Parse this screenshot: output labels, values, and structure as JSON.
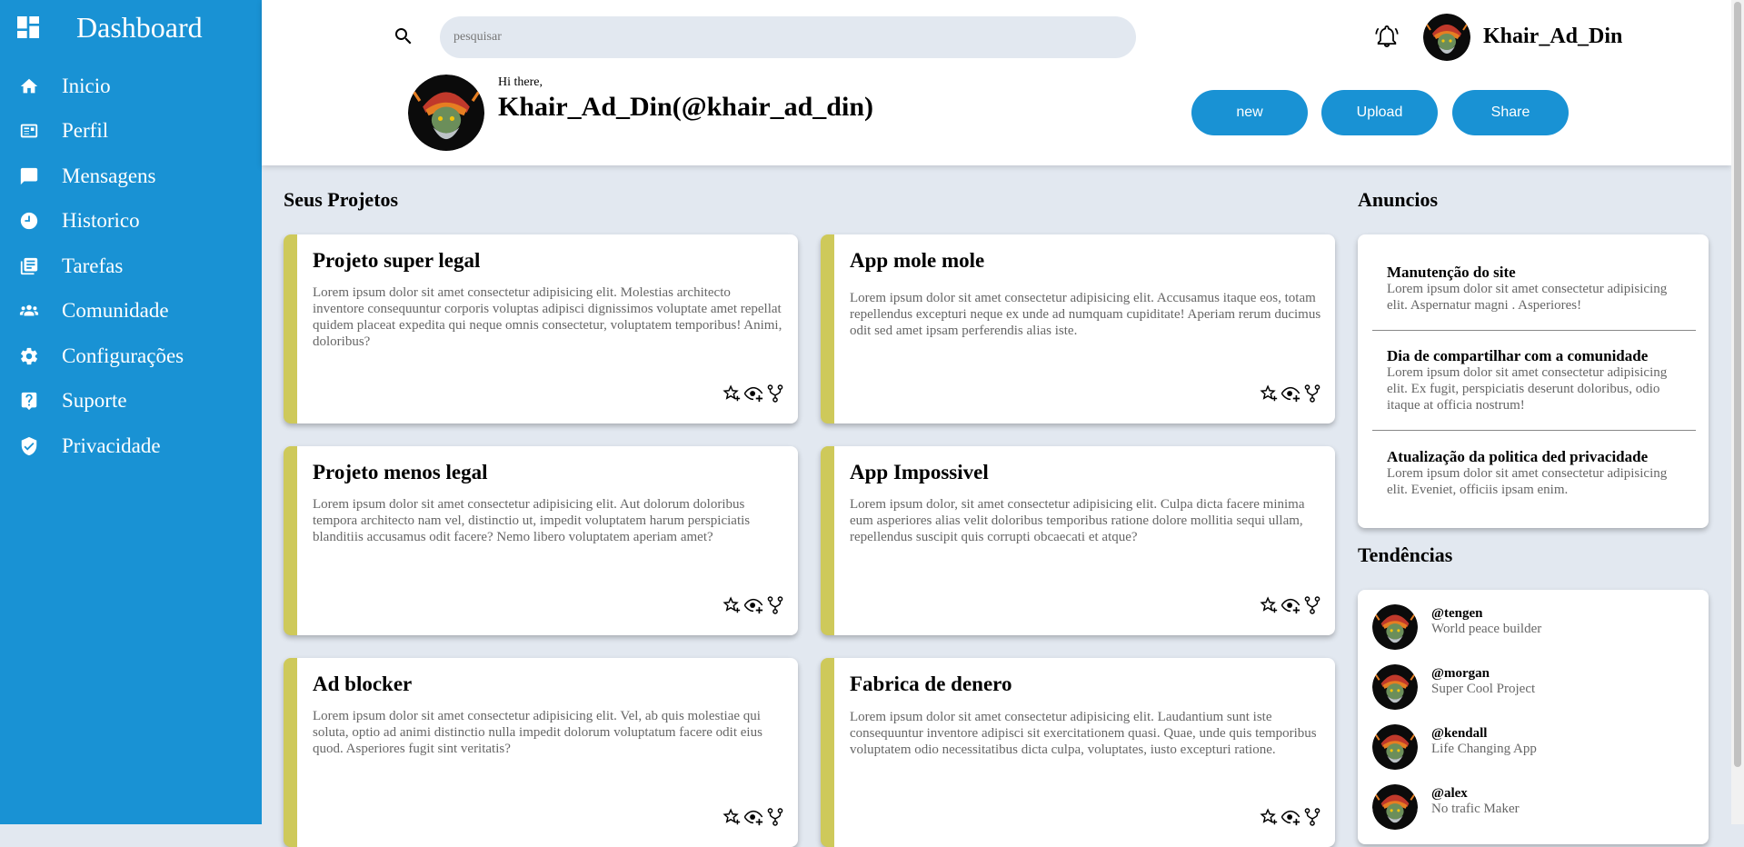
{
  "sidebar": {
    "title": "Dashboard",
    "items": [
      {
        "label": "Inicio",
        "icon": "home-icon"
      },
      {
        "label": "Perfil",
        "icon": "profile-card-icon"
      },
      {
        "label": "Mensagens",
        "icon": "message-icon"
      },
      {
        "label": "Historico",
        "icon": "clock-icon"
      },
      {
        "label": "Tarefas",
        "icon": "tasks-icon"
      },
      {
        "label": "Comunidade",
        "icon": "community-icon"
      },
      {
        "label": "Configurações",
        "icon": "gear-icon"
      },
      {
        "label": "Suporte",
        "icon": "help-icon"
      },
      {
        "label": "Privacidade",
        "icon": "shield-icon"
      }
    ]
  },
  "header": {
    "search_placeholder": "pesquisar",
    "username": "Khair_Ad_Din",
    "greeting": "Hi there,",
    "profile_handle": "Khair_Ad_Din(@khair_ad_din)",
    "buttons": {
      "new": "new",
      "upload": "Upload",
      "share": "Share"
    }
  },
  "projects": {
    "title": "Seus Projetos",
    "items": [
      {
        "title": "Projeto super legal",
        "text": "Lorem ipsum dolor sit amet consectetur adipisicing elit. Molestias architecto inventore consequuntur corporis voluptas adipisci dignissimos voluptate amet repellat quidem placeat expedita qui neque omnis consectetur, voluptatem temporibus! Animi, doloribus?"
      },
      {
        "title": "App mole mole",
        "text": "Lorem ipsum dolor sit amet consectetur adipisicing elit. Accusamus itaque eos, totam repellendus excepturi neque ex unde ad numquam cupiditate! Aperiam rerum ducimus odit sed amet ipsam perferendis alias iste."
      },
      {
        "title": "Projeto menos legal",
        "text": "Lorem ipsum dolor sit amet consectetur adipisicing elit. Aut dolorum doloribus tempora architecto nam vel, distinctio ut, impedit voluptatem harum perspiciatis blanditiis accusamus odit facere? Nemo libero voluptatem aperiam amet?"
      },
      {
        "title": "App Impossivel",
        "text": "Lorem ipsum dolor, sit amet consectetur adipisicing elit. Culpa dicta facere minima eum asperiores alias velit doloribus temporibus ratione dolore mollitia sequi ullam, repellendus suscipit quis corrupti obcaecati et atque?"
      },
      {
        "title": "Ad blocker",
        "text": "Lorem ipsum dolor sit amet consectetur adipisicing elit. Vel, ab quis molestiae qui soluta, optio ad animi distinctio nulla impedit dolorum voluptatum facere odit eius quod. Asperiores fugit sint veritatis?"
      },
      {
        "title": "Fabrica de denero",
        "text": "Lorem ipsum dolor sit amet consectetur adipisicing elit. Laudantium sunt iste consequuntur inventore adipisci sit exercitationem quasi. Quae, unde quis temporibus voluptatem odio necessitatibus dicta culpa, voluptates, iusto excepturi ratione."
      }
    ]
  },
  "announcements": {
    "title": "Anuncios",
    "items": [
      {
        "title": "Manutenção do site",
        "text": "Lorem ipsum dolor sit amet consectetur adipisicing elit. Aspernatur magni . Asperiores!"
      },
      {
        "title": "Dia de compartilhar com a comunidade",
        "text": "Lorem ipsum dolor sit amet consectetur adipisicing elit. Ex fugit, perspiciatis deserunt doloribus, odio itaque at officia nostrum!"
      },
      {
        "title": "Atualização da politica ded privacidade",
        "text": "Lorem ipsum dolor sit amet consectetur adipisicing elit. Eveniet, officiis ipsam enim."
      }
    ]
  },
  "trending": {
    "title": "Tendências",
    "items": [
      {
        "handle": "@tengen",
        "desc": "World peace builder"
      },
      {
        "handle": "@morgan",
        "desc": "Super Cool Project"
      },
      {
        "handle": "@kendall",
        "desc": "Life Changing App"
      },
      {
        "handle": "@alex",
        "desc": "No trafic Maker"
      }
    ]
  },
  "colors": {
    "sidebar": "#1992d4",
    "accent_bar": "#cec95a",
    "background": "#e2e8f0",
    "button": "#1992d4"
  }
}
